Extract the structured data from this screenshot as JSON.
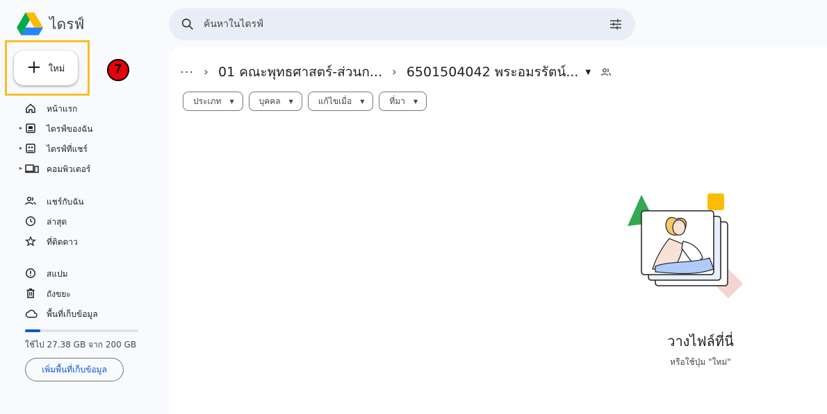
{
  "app": {
    "name": "ไดรฟ์"
  },
  "search": {
    "placeholder": "ค้นหาในไดรฟ์"
  },
  "new_button": {
    "label": "ใหม่"
  },
  "step_badge": "7",
  "sidebar": {
    "items": [
      {
        "label": "หน้าแรก",
        "icon": "home-icon"
      },
      {
        "label": "ไดรฟ์ของฉัน",
        "icon": "my-drive-icon"
      },
      {
        "label": "ไดรฟ์ที่แชร์",
        "icon": "shared-drives-icon"
      },
      {
        "label": "คอมพิวเตอร์",
        "icon": "computers-icon"
      },
      {
        "label": "แชร์กับฉัน",
        "icon": "people-icon"
      },
      {
        "label": "ล่าสุด",
        "icon": "clock-icon"
      },
      {
        "label": "ที่ติดดาว",
        "icon": "star-icon"
      },
      {
        "label": "สแปม",
        "icon": "spam-icon"
      },
      {
        "label": "ถังขยะ",
        "icon": "trash-icon"
      },
      {
        "label": "พื้นที่เก็บข้อมูล",
        "icon": "cloud-icon"
      }
    ]
  },
  "storage": {
    "used_text": "ใช้ไป 27.38 GB จาก 200 GB",
    "used_fraction": 0.137,
    "buy_label": "เพิ่มพื้นที่เก็บข้อมูล"
  },
  "breadcrumb": {
    "more": "···",
    "items": [
      "01 คณะพุทธศาสตร์-ส่วนก...",
      "6501504042 พระอมรรัตน์..."
    ]
  },
  "filters": [
    "ประเภท",
    "บุคคล",
    "แก้ไขเมื่อ",
    "ที่มา"
  ],
  "empty_state": {
    "title": "วางไฟล์ที่นี่",
    "subtitle": "หรือใช้ปุ่ม \"ใหม่\""
  },
  "colors": {
    "accent": "#0b57d0",
    "highlight": "#f6bf26",
    "badge": "#e8000a",
    "search_bg": "#e9eef6",
    "page_bg": "#f8fafd"
  }
}
